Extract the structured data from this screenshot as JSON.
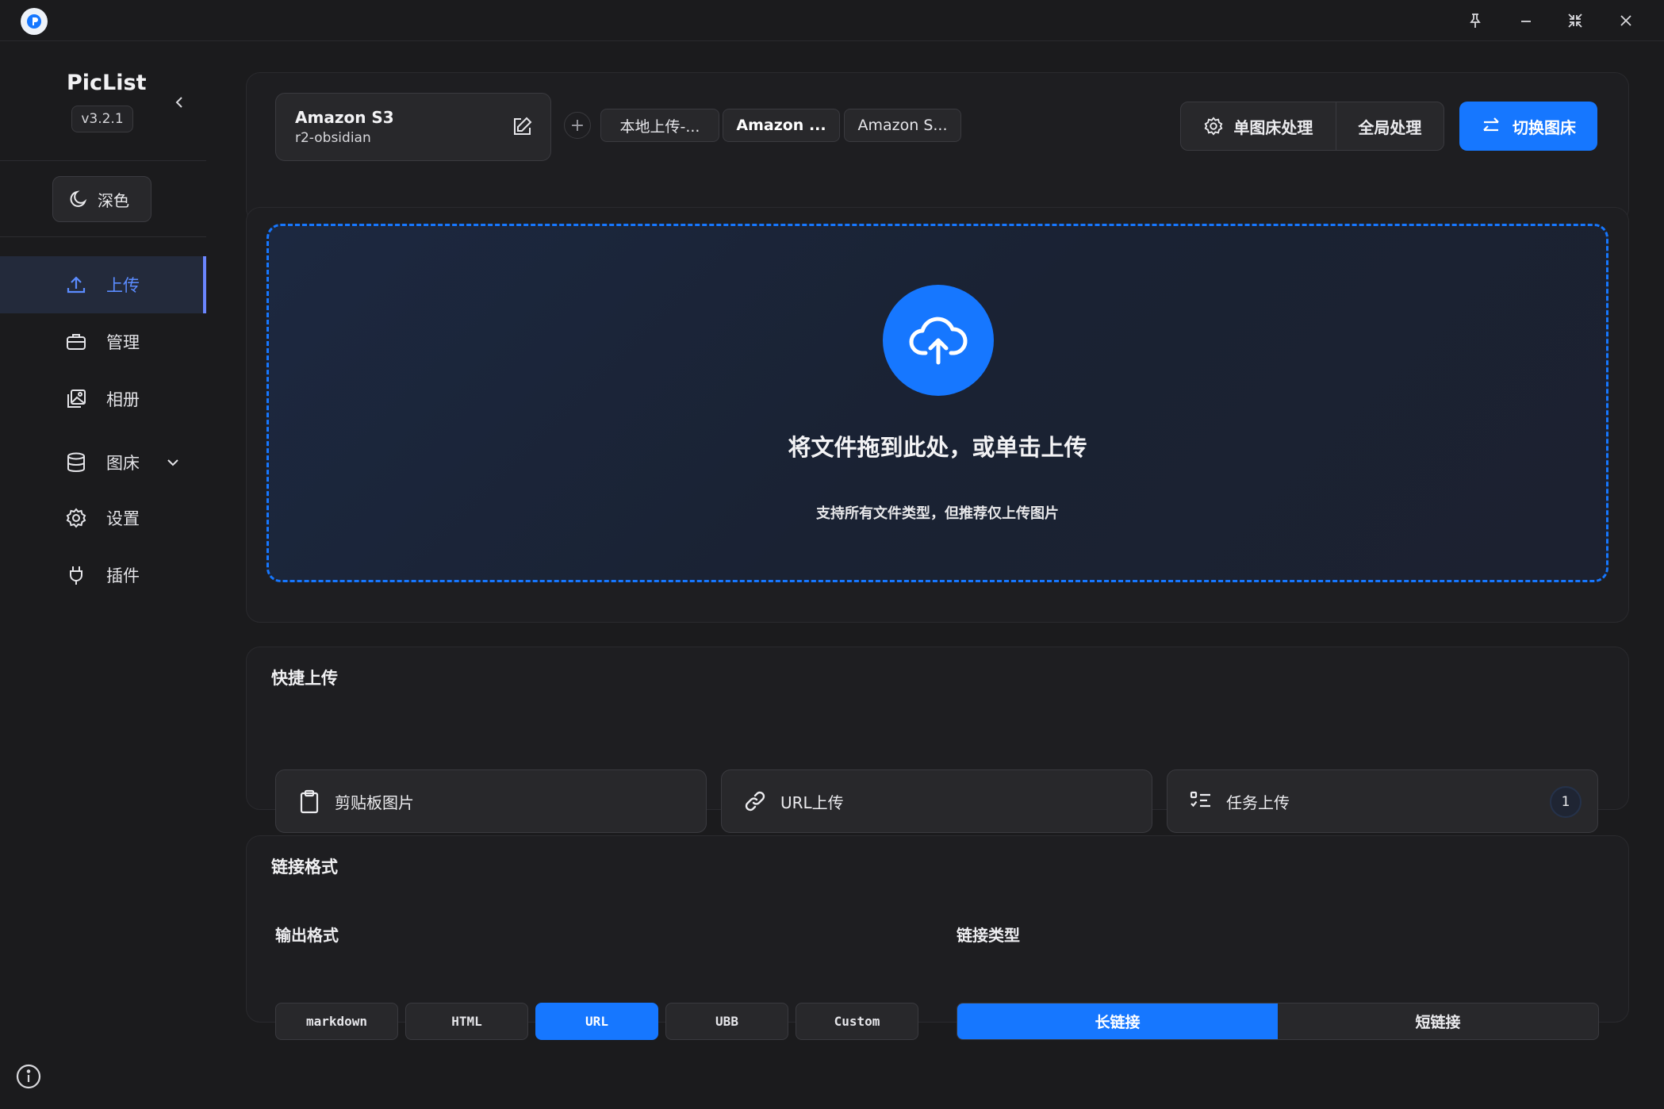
{
  "window": {
    "controls": [
      {
        "icon": "pin-icon"
      },
      {
        "icon": "minimize-icon"
      },
      {
        "icon": "compress-icon"
      },
      {
        "icon": "close-icon"
      }
    ]
  },
  "sidebar": {
    "brand": "PicList",
    "version": "v3.2.1",
    "theme_label": "深色",
    "items": [
      {
        "label": "上传",
        "icon": "upload-icon",
        "active": true
      },
      {
        "label": "管理",
        "icon": "briefcase-icon",
        "active": false
      },
      {
        "label": "相册",
        "icon": "gallery-icon",
        "active": false
      },
      {
        "label": "图床",
        "icon": "database-icon",
        "active": false
      },
      {
        "label": "设置",
        "icon": "gear-icon",
        "active": false
      },
      {
        "label": "插件",
        "icon": "plug-icon",
        "active": false
      }
    ]
  },
  "header": {
    "current_bed": {
      "name": "Amazon S3",
      "config": "r2-obsidian"
    },
    "bed_tabs": [
      "本地上传-...",
      "Amazon ...",
      "Amazon S..."
    ],
    "single_process_label": "单图床处理",
    "global_process_label": "全局处理",
    "switch_label": "切换图床"
  },
  "dropzone": {
    "title": "将文件拖到此处，或单击上传",
    "subtitle": "支持所有文件类型，但推荐仅上传图片"
  },
  "quick_upload": {
    "title": "快捷上传",
    "buttons": [
      {
        "label": "剪贴板图片",
        "icon": "clipboard-icon"
      },
      {
        "label": "URL上传",
        "icon": "link-icon"
      },
      {
        "label": "任务上传",
        "icon": "task-list-icon",
        "count": "1"
      }
    ]
  },
  "link_format": {
    "title": "链接格式",
    "output_label": "输出格式",
    "formats": [
      "markdown",
      "HTML",
      "URL",
      "UBB",
      "Custom"
    ],
    "selected_format": "URL",
    "link_type_label": "链接类型",
    "link_types": [
      "长链接",
      "短链接"
    ],
    "selected_link_type": "长链接"
  },
  "colors": {
    "accent": "#1677ff",
    "active_nav": "#5b8cff",
    "background": "#1b1b1d"
  }
}
